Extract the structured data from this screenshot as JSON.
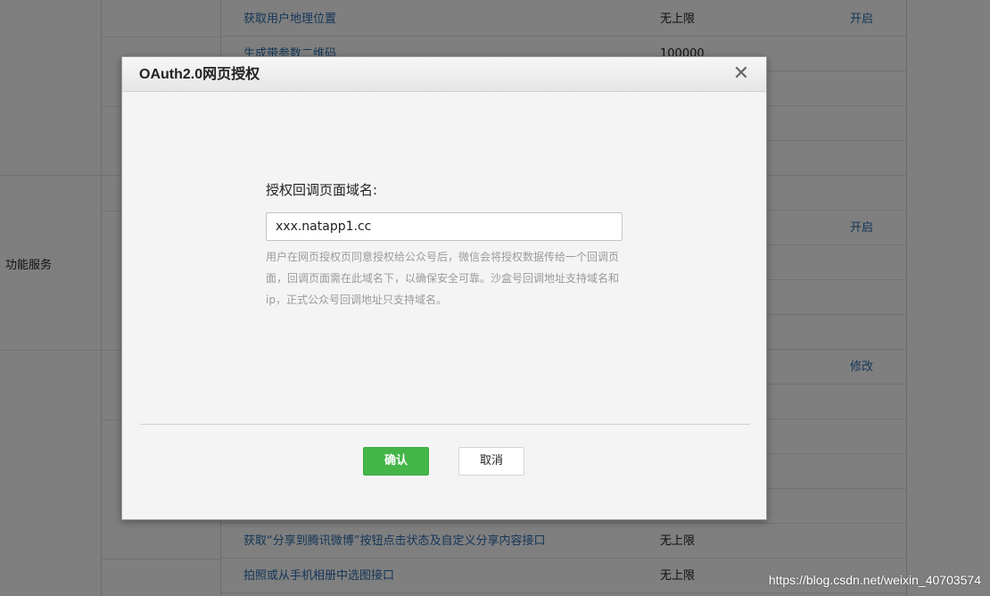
{
  "background": {
    "group_label": "功能服务",
    "rows": [
      {
        "api": "获取用户地理位置",
        "limit": "无上限",
        "op": "开启"
      },
      {
        "api": "生成带参数二维码",
        "limit": "100000",
        "op": ""
      },
      {
        "api": "",
        "limit": "",
        "op": ""
      },
      {
        "api": "",
        "limit": "",
        "op": ""
      },
      {
        "api": "",
        "limit": "",
        "op": ""
      },
      {
        "api": "",
        "limit": "",
        "op": ""
      },
      {
        "api": "",
        "limit": "",
        "op": "开启"
      },
      {
        "api": "",
        "limit": "",
        "op": ""
      },
      {
        "api": "",
        "limit": "",
        "op": ""
      },
      {
        "api": "",
        "limit": "",
        "op": ""
      },
      {
        "api": "",
        "limit": "",
        "op": "修改"
      },
      {
        "api": "",
        "limit": "",
        "op": ""
      },
      {
        "api": "",
        "limit": "",
        "op": ""
      },
      {
        "api": "",
        "limit": "",
        "op": ""
      },
      {
        "api": "",
        "limit": "",
        "op": ""
      },
      {
        "api": "获取“分享到腾讯微博”按钮点击状态及自定义分享内容接口",
        "limit": "无上限",
        "op": ""
      },
      {
        "api": "拍照或从手机相册中选图接口",
        "limit": "无上限",
        "op": ""
      }
    ]
  },
  "dialog": {
    "title": "OAuth2.0网页授权",
    "close_icon": "close-icon",
    "field_label": "授权回调页面域名:",
    "field_value": "xxx.natapp1.cc",
    "help_text": "用户在网页授权页同意授权给公众号后，微信会将授权数据传给一个回调页面，回调页面需在此域名下，以确保安全可靠。沙盒号回调地址支持域名和ip，正式公众号回调地址只支持域名。",
    "confirm_label": "确认",
    "cancel_label": "取消"
  },
  "colors": {
    "confirm_button": "#44b549",
    "link": "#2b6cb0"
  },
  "watermark": "https://blog.csdn.net/weixin_40703574"
}
